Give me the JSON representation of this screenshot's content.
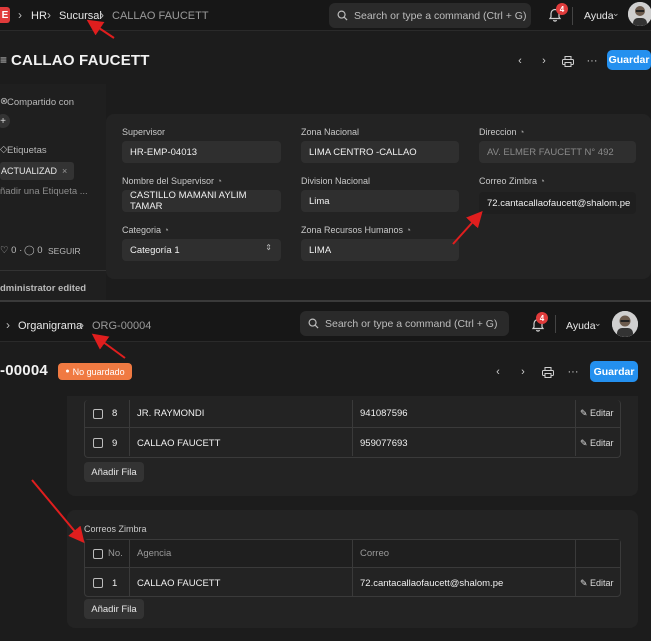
{
  "top": {
    "nav": {
      "app_logo": "E",
      "crumb_hr": "HR",
      "crumb_sucursal": "Sucursal",
      "crumb_current": "CALLAO FAUCETT",
      "search_placeholder": "Search or type a command (Ctrl + G)",
      "notif_count": "4",
      "ayuda": "Ayuda"
    },
    "title": "CALLAO FAUCETT",
    "save": "Guardar",
    "sidebar": {
      "compartido": "Compartido con",
      "plus": "+",
      "etiquetas": "Etiquetas",
      "tag": "ACTUALIZADO",
      "add_tag": "ñadir una Etiqueta ...",
      "likes": "0",
      "comments": "0",
      "seguir": "SEGUIR",
      "activity": "dministrator edited"
    },
    "form": {
      "supervisor_label": "Supervisor",
      "supervisor": "HR-EMP-04013",
      "zona_label": "Zona Nacional",
      "zona": "LIMA CENTRO -CALLAO",
      "direccion_label": "Direccion",
      "direccion": "AV. ELMER FAUCETT N° 492",
      "nombre_label": "Nombre del Supervisor",
      "nombre": "CASTILLO MAMANI AYLIM TAMAR",
      "division_label": "Division Nacional",
      "division": "Lima",
      "correo_label": "Correo Zimbra",
      "correo": "72.cantacallaofaucett@shalom.pe",
      "categoria_label": "Categoria",
      "categoria": "Categoría 1",
      "rrhh_label": "Zona Recursos Humanos",
      "rrhh": "LIMA"
    }
  },
  "bottom": {
    "nav": {
      "crumb_org": "Organigrama",
      "crumb_current": "ORG-00004",
      "search_placeholder": "Search or type a command (Ctrl + G)",
      "notif_count": "4",
      "ayuda": "Ayuda"
    },
    "title": "-00004",
    "unsaved": "No guardado",
    "save": "Guardar",
    "rows": [
      {
        "no": "8",
        "name": "JR. RAYMONDI",
        "phone": "941087596",
        "edit": "Editar"
      },
      {
        "no": "9",
        "name": "CALLAO FAUCETT",
        "phone": "959077693",
        "edit": "Editar"
      }
    ],
    "add_row": "Añadir Fila",
    "correos": {
      "section": "Correos Zimbra",
      "col_no": "No.",
      "col_agencia": "Agencia",
      "col_correo": "Correo",
      "row_no": "1",
      "row_agencia": "CALLAO FAUCETT",
      "row_correo": "72.cantacallaofaucett@shalom.pe",
      "row_edit": "Editar",
      "add_row": "Añadir Fila"
    }
  },
  "colors": {
    "accent": "#2490ef",
    "annotation": "#e01e1e",
    "unsaved": "#f07a42"
  }
}
